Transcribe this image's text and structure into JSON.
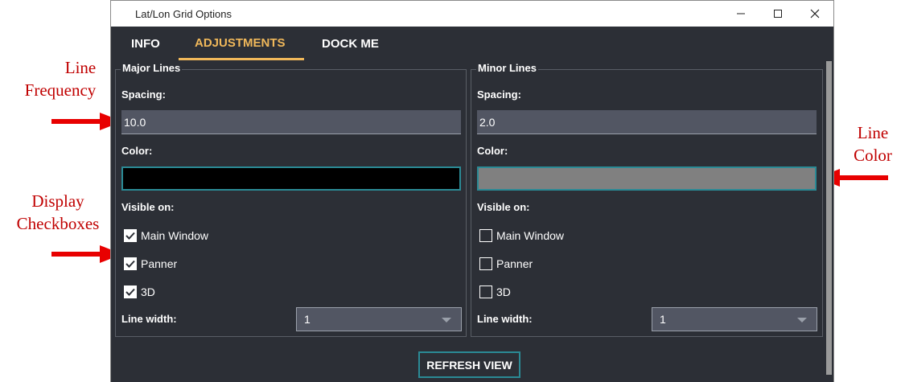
{
  "window": {
    "title": "Lat/Lon Grid Options"
  },
  "tabs": [
    {
      "label": "INFO"
    },
    {
      "label": "ADJUSTMENTS"
    },
    {
      "label": "DOCK ME"
    }
  ],
  "major": {
    "legend": "Major Lines",
    "spacing_label": "Spacing:",
    "spacing_value": "10.0",
    "color_label": "Color:",
    "color_value": "#000000",
    "visible_label": "Visible on:",
    "checkboxes": [
      {
        "label": "Main Window",
        "checked": true
      },
      {
        "label": "Panner",
        "checked": true
      },
      {
        "label": "3D",
        "checked": true
      }
    ],
    "line_width_label": "Line width:",
    "line_width_value": "1"
  },
  "minor": {
    "legend": "Minor Lines",
    "spacing_label": "Spacing:",
    "spacing_value": "2.0",
    "color_label": "Color:",
    "color_value": "#808080",
    "visible_label": "Visible on:",
    "checkboxes": [
      {
        "label": "Main Window",
        "checked": false
      },
      {
        "label": "Panner",
        "checked": false
      },
      {
        "label": "3D",
        "checked": false
      }
    ],
    "line_width_label": "Line width:",
    "line_width_value": "1"
  },
  "refresh_label": "REFRESH VIEW",
  "annotations": {
    "line_frequency": [
      "Line",
      "Frequency"
    ],
    "display_checkboxes": [
      "Display",
      "Checkboxes"
    ],
    "line_color": [
      "Line",
      "Color"
    ]
  },
  "colors": {
    "accent": "#f0b85a",
    "teal": "#2b8a95",
    "annotation": "#c00000"
  }
}
